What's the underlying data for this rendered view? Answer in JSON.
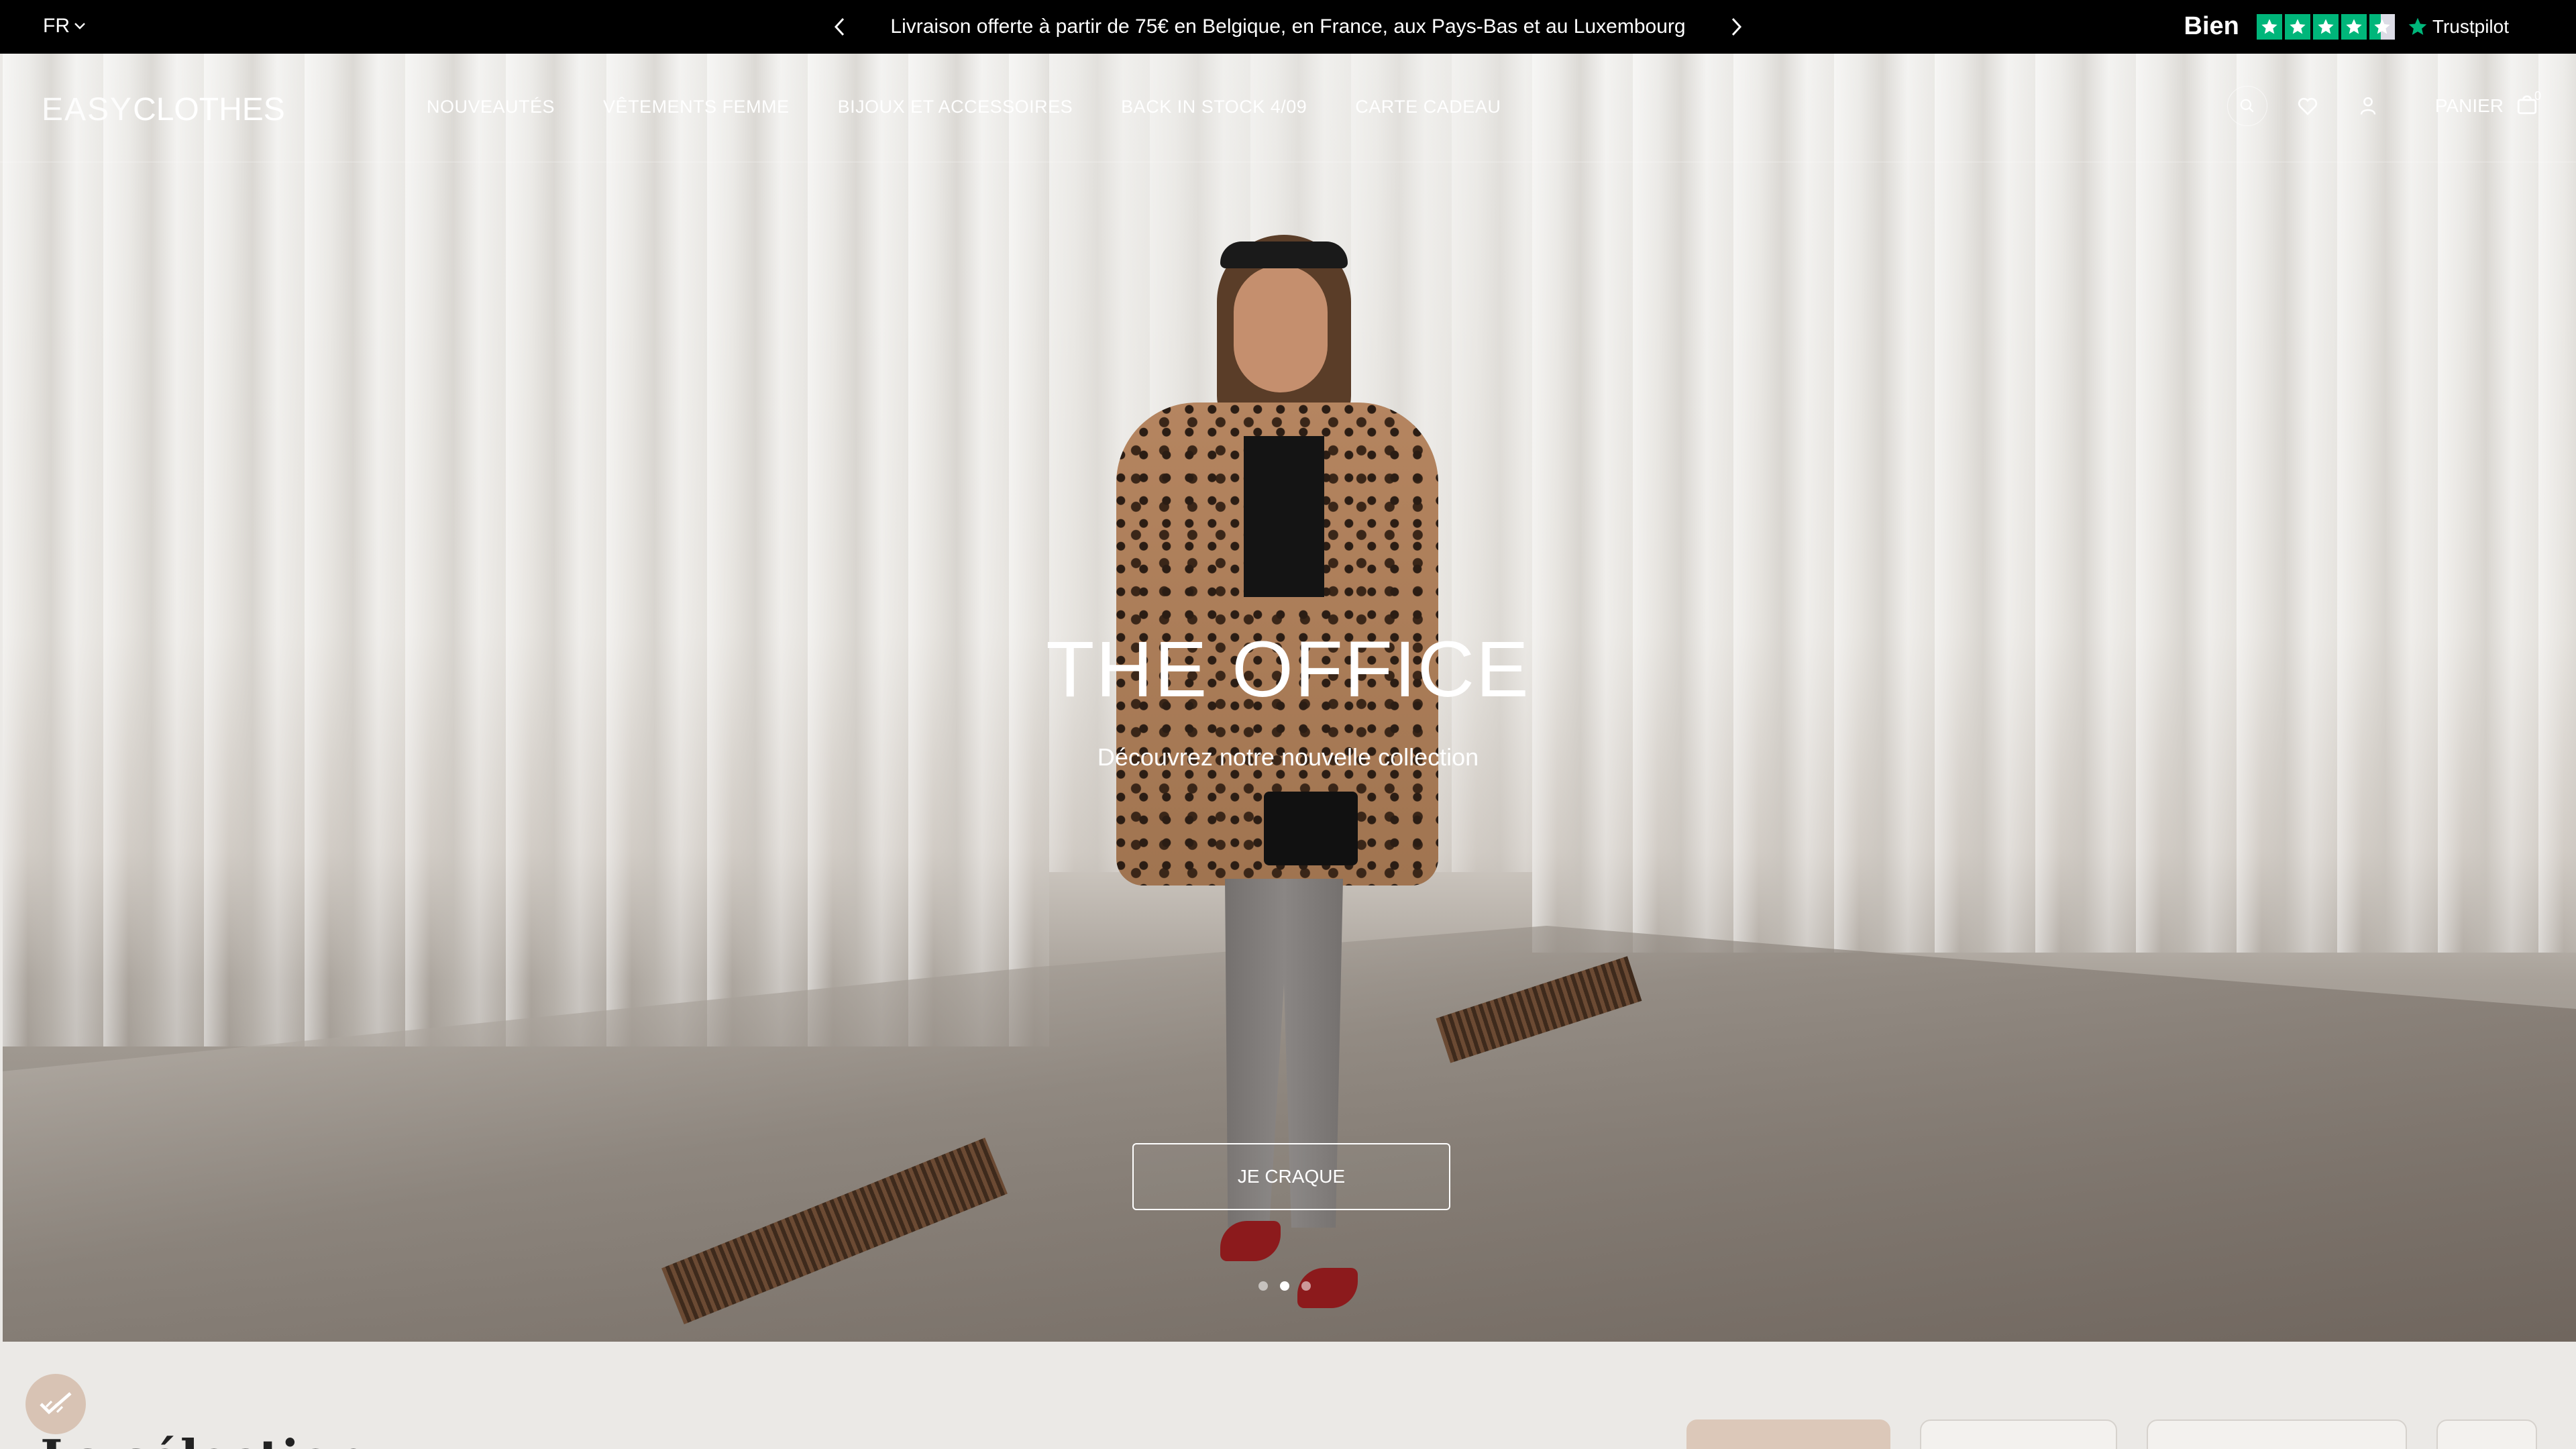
{
  "topbar": {
    "language": "FR",
    "announcement": "Livraison offerte à partir de 75€ en Belgique, en France, aux Pays-Bas et au Luxembourg",
    "trustpilot": {
      "rating_label": "Bien",
      "brand": "Trustpilot",
      "star_color": "#00b67a"
    }
  },
  "header": {
    "logo_easy": "EASY",
    "logo_clothes": "CLOTHES",
    "nav": [
      {
        "label": "NOUVEAUTÉS"
      },
      {
        "label": "VÊTEMENTS FEMME"
      },
      {
        "label": "BIJOUX ET ACCESSOIRES"
      },
      {
        "label": "BACK IN STOCK 4/09"
      },
      {
        "label": "CARTE CADEAU"
      }
    ],
    "cart_label": "PANIER",
    "cart_count": "0",
    "icons": [
      "search-icon",
      "heart-icon",
      "user-icon",
      "bag-icon"
    ]
  },
  "hero": {
    "title": "THE OFFICE",
    "subtitle": "Découvrez notre nouvelle collection",
    "cta": "JE CRAQUE",
    "slides": 3,
    "active_slide": 2
  },
  "below": {
    "section_title": "La sélection"
  }
}
